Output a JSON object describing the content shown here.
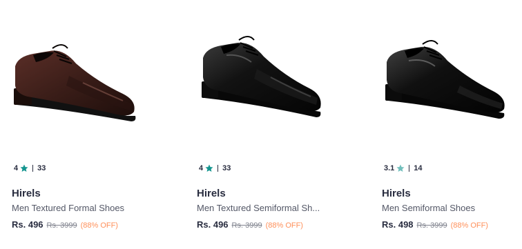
{
  "colors": {
    "star_green": "#14958f",
    "star_light": "#72bfbc",
    "discount": "#ff905a",
    "text_primary": "#282c3f",
    "text_secondary": "#535766"
  },
  "products": [
    {
      "rating": "4",
      "star_icon": "star-icon",
      "rating_count": "33",
      "brand": "Hirels",
      "title": "Men Textured Formal Shoes",
      "price": "Rs. 496",
      "mrp": "Rs. 3999",
      "discount": "(88% OFF)",
      "shoe_color": "#3a1d18"
    },
    {
      "rating": "4",
      "star_icon": "star-icon",
      "rating_count": "33",
      "brand": "Hirels",
      "title": "Men Textured Semiformal Sh...",
      "price": "Rs. 496",
      "mrp": "Rs. 3999",
      "discount": "(88% OFF)",
      "shoe_color": "#0d0d0d"
    },
    {
      "rating": "3.1",
      "star_icon": "star-icon",
      "rating_count": "14",
      "brand": "Hirels",
      "title": "Men Semiformal Shoes",
      "price": "Rs. 498",
      "mrp": "Rs. 3999",
      "discount": "(88% OFF)",
      "shoe_color": "#0a0a0a"
    }
  ]
}
